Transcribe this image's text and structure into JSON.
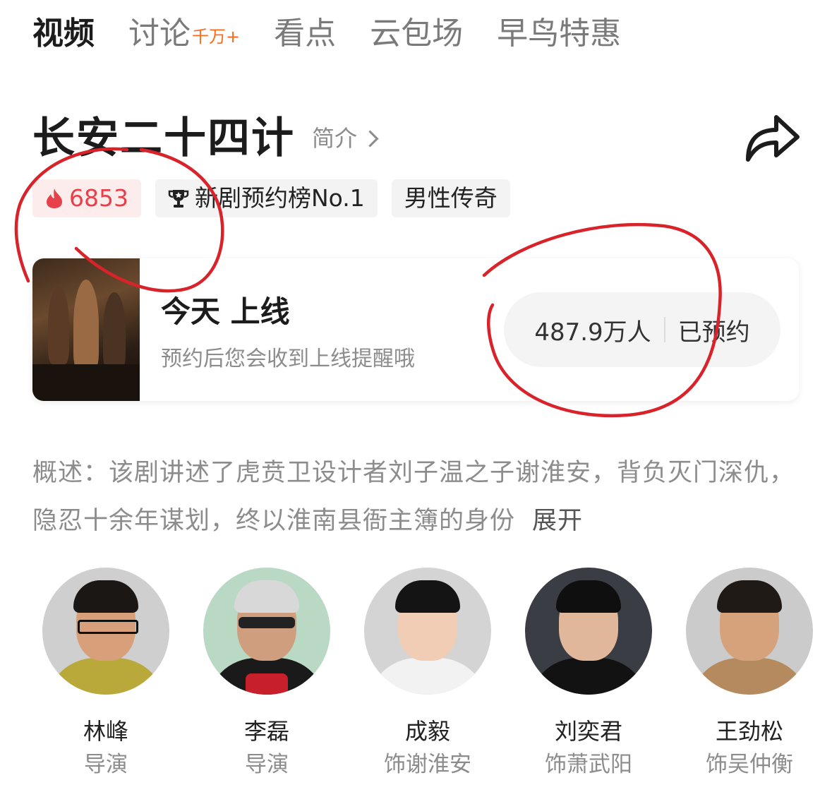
{
  "tabs": [
    {
      "label": "视频",
      "active": true
    },
    {
      "label": "讨论",
      "sup": "千万+"
    },
    {
      "label": "看点"
    },
    {
      "label": "云包场"
    },
    {
      "label": "早鸟特惠"
    }
  ],
  "show": {
    "title": "长安二十四计",
    "intro_link": "简介",
    "share_icon": "share-icon"
  },
  "badges": {
    "heat": "6853",
    "rank": "新剧预约榜No.1",
    "genre": "男性传奇"
  },
  "release": {
    "title": "今天 上线",
    "subtitle": "预约后您会收到上线提醒哦",
    "count": "487.9万人",
    "status": "已预约"
  },
  "description": {
    "text": "概述：该剧讲述了虎贲卫设计者刘子温之子谢淮安，背负灭门深仇，隐忍十余年谋划，终以淮南县衙主簿的身份",
    "more": "展开"
  },
  "cast": [
    {
      "name": "林峰",
      "role": "导演"
    },
    {
      "name": "李磊",
      "role": "导演"
    },
    {
      "name": "成毅",
      "role": "饰谢淮安"
    },
    {
      "name": "刘奕君",
      "role": "饰萧武阳"
    },
    {
      "name": "王劲松",
      "role": "饰吴仲衡"
    }
  ],
  "colors": {
    "accent_orange": "#ff6a1a",
    "heat_red": "#e8404a",
    "annotation_red": "#d8232a"
  }
}
